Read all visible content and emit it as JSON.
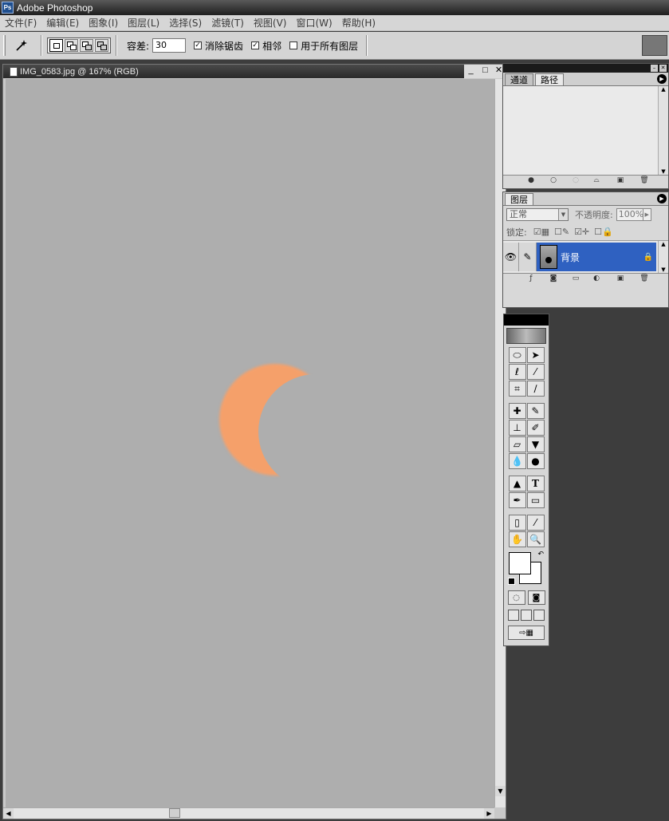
{
  "app": {
    "title": "Adobe Photoshop",
    "logo_text": "Ps"
  },
  "menu": {
    "items": [
      "文件(F)",
      "编辑(E)",
      "图象(I)",
      "图层(L)",
      "选择(S)",
      "滤镜(T)",
      "视图(V)",
      "窗口(W)",
      "帮助(H)"
    ]
  },
  "options": {
    "current_tool_icon": "magic-wand-icon",
    "tolerance_label": "容差:",
    "tolerance_value": "30",
    "antialias_label": "消除锯齿",
    "antialias_checked": true,
    "contiguous_label": "相邻",
    "contiguous_checked": true,
    "all_layers_label": "用于所有图层",
    "all_layers_checked": false
  },
  "document": {
    "title": "IMG_0583.jpg @ 167% (RGB)",
    "background_color": "#aeaeae",
    "crescent_color": "#f5a06a"
  },
  "channels_panel": {
    "tabs": [
      "通道",
      "路径"
    ],
    "active_tab": 1
  },
  "layers_panel": {
    "tab": "图层",
    "blend_mode": "正常",
    "opacity_label": "不透明度:",
    "opacity_value": "100%",
    "lock_label": "锁定:",
    "layers": [
      {
        "name": "背景",
        "visible": true,
        "selected": true,
        "locked": true
      }
    ],
    "selected_color": "#2f61c1"
  },
  "toolbox": {
    "tools": [
      "marquee-icon",
      "move-icon",
      "lasso-icon",
      "magic-wand-icon",
      "crop-icon",
      "slice-icon",
      "healing-brush-icon",
      "brush-icon",
      "clone-stamp-icon",
      "history-brush-icon",
      "eraser-icon",
      "paint-bucket-icon",
      "blur-icon",
      "dodge-icon",
      "path-selection-icon",
      "type-icon",
      "pen-icon",
      "rectangle-icon",
      "notes-icon",
      "eyedropper-icon",
      "hand-icon",
      "zoom-icon"
    ],
    "type_tool_label": "T",
    "foreground_color": "#ffffff",
    "background_color": "#ffffff"
  }
}
